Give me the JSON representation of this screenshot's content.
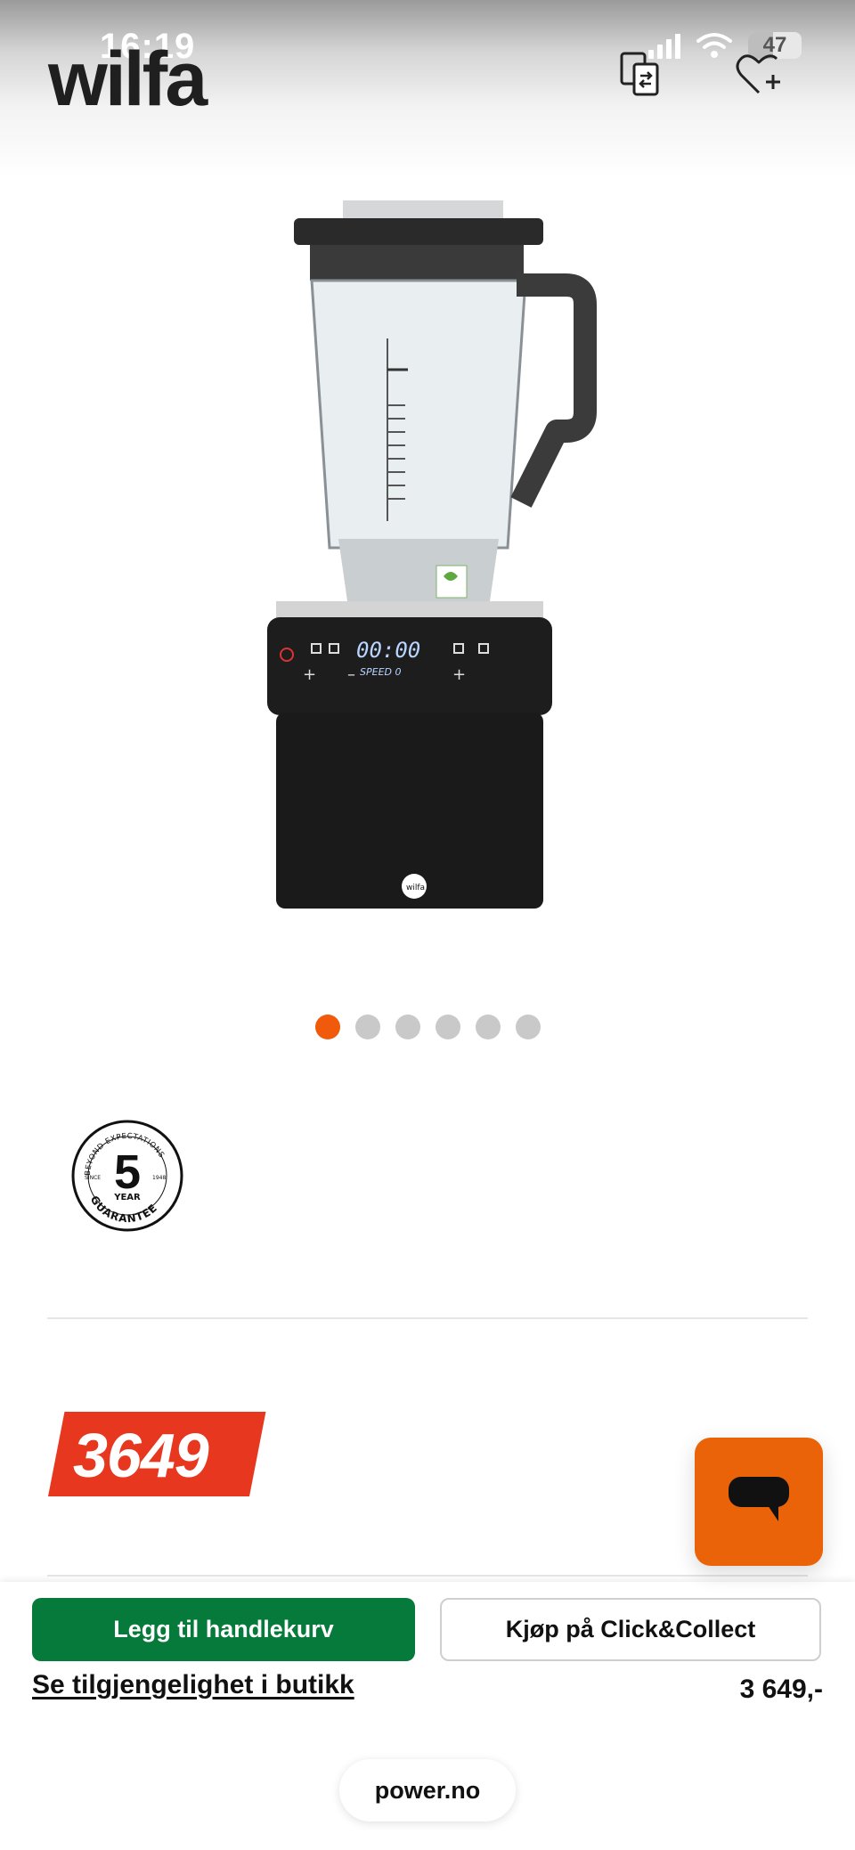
{
  "status_bar": {
    "time": "16:19",
    "battery": "47",
    "icons": [
      "signal-icon",
      "wifi-icon",
      "battery-icon"
    ]
  },
  "header": {
    "brand": "wilfa",
    "icons": [
      "compare-icon",
      "wishlist-add-icon"
    ]
  },
  "product": {
    "image_icon": "blender-product-image",
    "display_time": "00:00",
    "display_speed": "SPEED 0",
    "carousel": {
      "total": 6,
      "active_index": 0
    },
    "guarantee": {
      "years": "5",
      "top_text": "BEYOND EXPECTATIONS",
      "since": "SINCE",
      "year_est": "1948",
      "year_word": "YEAR",
      "bottom_text": "GUARANTEE"
    },
    "price_badge": "3649"
  },
  "colors": {
    "accent": "#f15a0a",
    "price": "#e8371f",
    "cart_button": "#067a3a",
    "chat": "#ea6308"
  },
  "actions": {
    "add_to_cart": "Legg til handlekurv",
    "click_collect": "Kjøp på Click&Collect",
    "availability": "Se tilgjengelighet i butikk",
    "price": "3 649,-"
  },
  "browser": {
    "url": "power.no"
  }
}
